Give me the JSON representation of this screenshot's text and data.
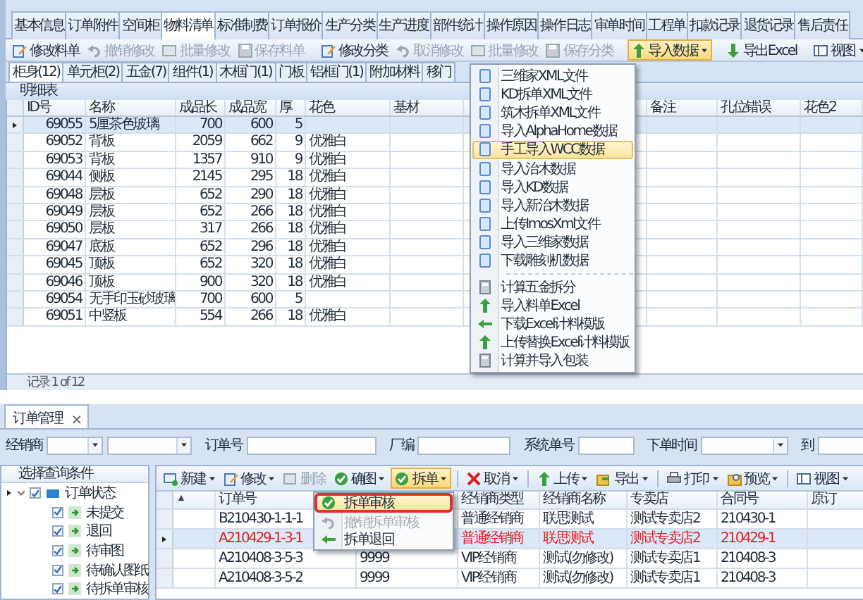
{
  "main_tabs": [
    {
      "label": "基本信息",
      "selected": false
    },
    {
      "label": "订单附件",
      "selected": false
    },
    {
      "label": "空间柜",
      "selected": false
    },
    {
      "label": "物料清单",
      "selected": true
    },
    {
      "label": "标准制费",
      "selected": false
    },
    {
      "label": "订单报价",
      "selected": false
    },
    {
      "label": "生产分类",
      "selected": false
    },
    {
      "label": "生产进度",
      "selected": false
    },
    {
      "label": "部件统计",
      "selected": false
    },
    {
      "label": "操作原因",
      "selected": false
    },
    {
      "label": "操作日志",
      "selected": false
    },
    {
      "label": "审单时间",
      "selected": false
    },
    {
      "label": "工程单",
      "selected": false
    },
    {
      "label": "扣款记录",
      "selected": false
    },
    {
      "label": "退货记录",
      "selected": false
    },
    {
      "label": "售后责任",
      "selected": false
    }
  ],
  "toolbar": [
    {
      "label": "修改料单",
      "disabled": false,
      "dropdown": false,
      "active": false
    },
    {
      "label": "撤销修改",
      "disabled": true,
      "dropdown": false,
      "active": false
    },
    {
      "label": "批量修改",
      "disabled": true,
      "dropdown": false,
      "active": false
    },
    {
      "label": "保存料单",
      "disabled": true,
      "dropdown": false,
      "active": false
    },
    {
      "label": "修改分类",
      "disabled": false,
      "dropdown": false,
      "active": false
    },
    {
      "label": "取消修改",
      "disabled": true,
      "dropdown": false,
      "active": false
    },
    {
      "label": "批量修改",
      "disabled": true,
      "dropdown": false,
      "active": false
    },
    {
      "label": "保存分类",
      "disabled": true,
      "dropdown": false,
      "active": false
    },
    {
      "label": "导入数据",
      "disabled": false,
      "dropdown": true,
      "active": true
    },
    {
      "label": "导出Excel",
      "disabled": false,
      "dropdown": false,
      "active": false
    },
    {
      "label": "视图",
      "disabled": false,
      "dropdown": true,
      "active": false
    }
  ],
  "import_menu": [
    {
      "label": "三维家XML文件",
      "selected": false
    },
    {
      "label": "KD拆单XML文件",
      "selected": false
    },
    {
      "label": "筑木拆单XML文件",
      "selected": false
    },
    {
      "label": "导入AlphaHome数据",
      "selected": false
    },
    {
      "label": "手工导入WCC数据",
      "selected": true
    },
    {
      "label": "导入治木数据",
      "selected": false
    },
    {
      "label": "导入KD数据",
      "selected": false
    },
    {
      "label": "导入新治木数据",
      "selected": false
    },
    {
      "label": "上传ImosXml文件",
      "selected": false
    },
    {
      "label": "导入三维家数据",
      "selected": false
    },
    {
      "label": "下载雕刻机数据",
      "selected": false
    },
    {
      "label": "计算五金拆分",
      "selected": false
    },
    {
      "label": "导入料单Excel",
      "selected": false
    },
    {
      "label": "下载Excel计料模版",
      "selected": false
    },
    {
      "label": "上传替换Excel计料模版",
      "selected": false
    },
    {
      "label": "计算并导入包装",
      "selected": false
    }
  ],
  "category_tabs": [
    {
      "label": "柜身(12)",
      "selected": true
    },
    {
      "label": "单元柜(2)",
      "selected": false
    },
    {
      "label": "五金(7)",
      "selected": false
    },
    {
      "label": "组件(1)",
      "selected": false
    },
    {
      "label": "木框门(1)",
      "selected": false
    },
    {
      "label": "门板",
      "selected": false
    },
    {
      "label": "铝框门(1)",
      "selected": false
    },
    {
      "label": "附加材料",
      "selected": false
    },
    {
      "label": "移门",
      "selected": false
    }
  ],
  "detail_table": {
    "title": "明细表",
    "columns": [
      "ID号",
      "名称",
      "成品长",
      "成品宽",
      "厚",
      "花色",
      "基材",
      null,
      "备注",
      "孔位错误",
      "花色2"
    ],
    "rows": [
      {
        "current": true,
        "cells": [
          "69055",
          "5厘茶色玻璃",
          "700",
          "600",
          "5",
          null
        ]
      },
      {
        "current": false,
        "cells": [
          "69052",
          "背板",
          "2059",
          "662",
          "9",
          "优雅白"
        ]
      },
      {
        "current": false,
        "cells": [
          "69053",
          "背板",
          "1357",
          "910",
          "9",
          "优雅白"
        ]
      },
      {
        "current": false,
        "cells": [
          "69044",
          "侧板",
          "2145",
          "295",
          "18",
          "优雅白"
        ]
      },
      {
        "current": false,
        "cells": [
          "69048",
          "层板",
          "652",
          "290",
          "18",
          "优雅白"
        ]
      },
      {
        "current": false,
        "cells": [
          "69049",
          "层板",
          "652",
          "266",
          "18",
          "优雅白"
        ]
      },
      {
        "current": false,
        "cells": [
          "69050",
          "层板",
          "317",
          "266",
          "18",
          "优雅白"
        ]
      },
      {
        "current": false,
        "cells": [
          "69047",
          "底板",
          "652",
          "296",
          "18",
          "优雅白"
        ]
      },
      {
        "current": false,
        "cells": [
          "69045",
          "顶板",
          "652",
          "320",
          "18",
          "优雅白"
        ]
      },
      {
        "current": false,
        "cells": [
          "69046",
          "顶板",
          "900",
          "320",
          "18",
          "优雅白"
        ]
      },
      {
        "current": false,
        "cells": [
          "69054",
          "无手印玉砂玻璃",
          "700",
          "600",
          "5",
          null
        ]
      },
      {
        "current": false,
        "cells": [
          "69051",
          "中竖板",
          "554",
          "266",
          "18",
          "优雅白"
        ]
      }
    ],
    "pager": "记录 1 of 12"
  },
  "order_window": {
    "tab": "订单管理",
    "close": "×",
    "filters": [
      {
        "label": "经销商",
        "kind": "combo2"
      },
      {
        "label": "订单号",
        "kind": "text"
      },
      {
        "label": "厂编",
        "kind": "text"
      },
      {
        "label": "系统单号",
        "kind": "text"
      },
      {
        "label": "下单时间",
        "kind": "combo"
      },
      {
        "label": "到",
        "kind": "combo"
      }
    ],
    "tree": {
      "title": "选择查询条件",
      "items": [
        {
          "label": "订单状态",
          "checked": true,
          "expanded": true,
          "children": [
            {
              "label": "未提交",
              "checked": true
            },
            {
              "label": "退回",
              "checked": true
            },
            {
              "label": "待审图",
              "checked": true
            },
            {
              "label": "待确认图纸",
              "checked": true
            },
            {
              "label": "待拆单审核",
              "checked": true
            }
          ]
        }
      ]
    },
    "toolbar": [
      {
        "label": "新建",
        "disabled": false,
        "dropdown": true,
        "active": false
      },
      {
        "label": "修改",
        "disabled": false,
        "dropdown": true,
        "active": false
      },
      {
        "label": "删除",
        "disabled": true,
        "dropdown": false,
        "active": false
      },
      {
        "label": "确图",
        "disabled": false,
        "dropdown": true,
        "active": false
      },
      {
        "label": "拆单",
        "disabled": false,
        "dropdown": true,
        "active": true
      },
      {
        "label": "取消",
        "disabled": false,
        "dropdown": true,
        "active": false
      },
      {
        "label": "上传",
        "disabled": false,
        "dropdown": true,
        "active": false
      },
      {
        "label": "导出",
        "disabled": false,
        "dropdown": true,
        "active": false
      },
      {
        "label": "打印",
        "disabled": false,
        "dropdown": true,
        "active": false
      },
      {
        "label": "预览",
        "disabled": false,
        "dropdown": true,
        "active": false
      },
      {
        "label": "视图",
        "disabled": false,
        "dropdown": true,
        "active": false
      }
    ],
    "split_menu": [
      {
        "label": "拆单审核",
        "selected": true,
        "disabled": false,
        "marked": true
      },
      {
        "label": "撤销拆单审核",
        "selected": false,
        "disabled": true,
        "marked": false
      },
      {
        "label": "拆单退回",
        "selected": false,
        "disabled": false,
        "marked": false
      }
    ],
    "columns": [
      "订单号",
      null,
      "经销商类型",
      "经销商名称",
      "专卖店",
      "合同号",
      "原订"
    ],
    "rows": [
      {
        "current": false,
        "highlight": false,
        "cells": [
          "B210430-1-1-1",
          null,
          "普通经销商",
          "联思测试",
          "测试专卖店2",
          "210430-1"
        ]
      },
      {
        "current": true,
        "highlight": true,
        "cells": [
          "A210429-1-3-1",
          null,
          "普通经销商",
          "联思测试",
          "测试专卖店2",
          "210429-1"
        ]
      },
      {
        "current": false,
        "highlight": false,
        "cells": [
          "A210408-3-5-3",
          "9999",
          "VIP经销商",
          "测试(勿修改)",
          "测试专卖店1",
          "210408-3"
        ]
      },
      {
        "current": false,
        "highlight": false,
        "cells": [
          "A210408-3-5-2",
          "9999",
          "VIP经销商",
          "测试(勿修改)",
          "测试专卖店1",
          "210408-3"
        ]
      }
    ]
  }
}
